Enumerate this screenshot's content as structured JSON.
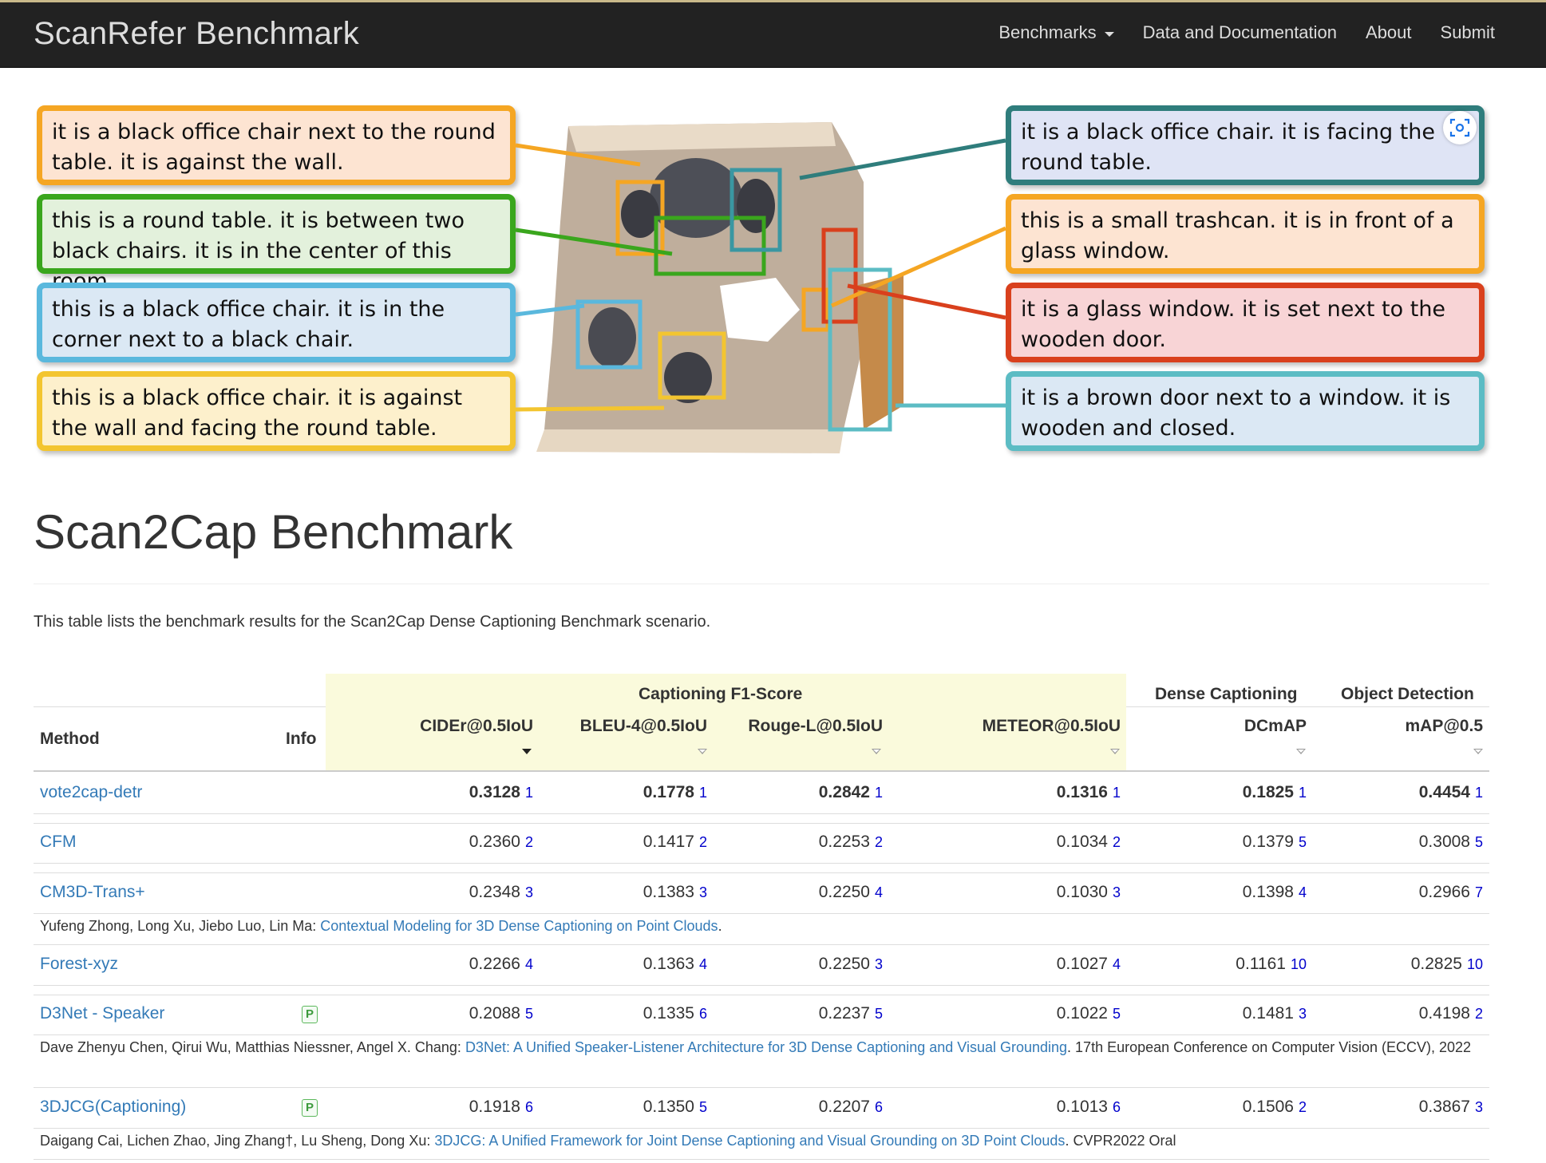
{
  "navbar": {
    "brand": "ScanRefer Benchmark",
    "items": [
      "Benchmarks",
      "Data and Documentation",
      "About",
      "Submit"
    ]
  },
  "teaser": {
    "left_captions": [
      {
        "text": "it is a black office chair next to the round table. it is against the wall.",
        "color": "#f5a623",
        "fill": "#fde4d2"
      },
      {
        "text": "this is a round table. it is between two black chairs. it is in the center of this room.",
        "color": "#3aa61d",
        "fill": "#e3f1dc"
      },
      {
        "text": "this is a black office chair. it is in the corner next to a black chair.",
        "color": "#5ab8dd",
        "fill": "#dbe8f4"
      },
      {
        "text": "this is a black office chair. it is against the wall and facing the round table.",
        "color": "#f3c530",
        "fill": "#fdf0cc"
      }
    ],
    "right_captions": [
      {
        "text": "it is a black office chair. it is facing the round table.",
        "color": "#2f7d7c",
        "fill": "#dfe4f5"
      },
      {
        "text": "this is a small trashcan. it is in front of a glass window.",
        "color": "#f5a623",
        "fill": "#fde4d2"
      },
      {
        "text": "it is a glass window. it is set next to the wooden door.",
        "color": "#d9401d",
        "fill": "#f8d4d6"
      },
      {
        "text": "it is a brown door next to a window. it is wooden and closed.",
        "color": "#5cbcc4",
        "fill": "#dbe8f4"
      }
    ],
    "fullscreen_icon": "focus-scan-icon"
  },
  "page": {
    "title": "Scan2Cap Benchmark",
    "description": "This table lists the benchmark results for the Scan2Cap Dense Captioning Benchmark scenario."
  },
  "table": {
    "group_headers": {
      "captioning": "Captioning F1-Score",
      "dense": "Dense Captioning",
      "detection": "Object Detection"
    },
    "columns": {
      "method": "Method",
      "info": "Info",
      "cider": "CIDEr@0.5IoU",
      "bleu": "BLEU-4@0.5IoU",
      "rouge": "Rouge-L@0.5IoU",
      "meteor": "METEOR@0.5IoU",
      "dcmap": "DCmAP",
      "map": "mAP@0.5"
    },
    "rows": [
      {
        "method": "vote2cap-detr",
        "pub": false,
        "cider": "0.3128",
        "cider_r": "1",
        "bleu": "0.1778",
        "bleu_r": "1",
        "rouge": "0.2842",
        "rouge_r": "1",
        "meteor": "0.1316",
        "meteor_r": "1",
        "dcmap": "0.1825",
        "dcmap_r": "1",
        "map": "0.4454",
        "map_r": "1",
        "bold": true
      },
      {
        "method": "CFM",
        "pub": false,
        "cider": "0.2360",
        "cider_r": "2",
        "bleu": "0.1417",
        "bleu_r": "2",
        "rouge": "0.2253",
        "rouge_r": "2",
        "meteor": "0.1034",
        "meteor_r": "2",
        "dcmap": "0.1379",
        "dcmap_r": "5",
        "map": "0.3008",
        "map_r": "5"
      },
      {
        "method": "CM3D-Trans+",
        "pub": false,
        "cider": "0.2348",
        "cider_r": "3",
        "bleu": "0.1383",
        "bleu_r": "3",
        "rouge": "0.2250",
        "rouge_r": "4",
        "meteor": "0.1030",
        "meteor_r": "3",
        "dcmap": "0.1398",
        "dcmap_r": "4",
        "map": "0.2966",
        "map_r": "7",
        "cite": {
          "authors": "Yufeng Zhong, Long Xu, Jiebo Luo, Lin Ma: ",
          "title": "Contextual Modeling for 3D Dense Captioning on Point Clouds",
          "venue": "."
        }
      },
      {
        "method": "Forest-xyz",
        "pub": false,
        "cider": "0.2266",
        "cider_r": "4",
        "bleu": "0.1363",
        "bleu_r": "4",
        "rouge": "0.2250",
        "rouge_r": "3",
        "meteor": "0.1027",
        "meteor_r": "4",
        "dcmap": "0.1161",
        "dcmap_r": "10",
        "map": "0.2825",
        "map_r": "10"
      },
      {
        "method": "D3Net - Speaker",
        "pub": true,
        "cider": "0.2088",
        "cider_r": "5",
        "bleu": "0.1335",
        "bleu_r": "6",
        "rouge": "0.2237",
        "rouge_r": "5",
        "meteor": "0.1022",
        "meteor_r": "5",
        "dcmap": "0.1481",
        "dcmap_r": "3",
        "map": "0.4198",
        "map_r": "2",
        "cite": {
          "authors": "Dave Zhenyu Chen, Qirui Wu, Matthias Niessner, Angel X. Chang: ",
          "title": "D3Net: A Unified Speaker-Listener Architecture for 3D Dense Captioning and Visual Grounding",
          "venue": ". 17th European Conference on Computer Vision (ECCV), 2022"
        }
      },
      {
        "method": "3DJCG(Captioning)",
        "pub": true,
        "cider": "0.1918",
        "cider_r": "6",
        "bleu": "0.1350",
        "bleu_r": "5",
        "rouge": "0.2207",
        "rouge_r": "6",
        "meteor": "0.1013",
        "meteor_r": "6",
        "dcmap": "0.1506",
        "dcmap_r": "2",
        "map": "0.3867",
        "map_r": "3",
        "cite": {
          "authors": "Daigang Cai, Lichen Zhao, Jing Zhang†, Lu Sheng, Dong Xu: ",
          "title": "3DJCG: A Unified Framework for Joint Dense Captioning and Visual Grounding on 3D Point Clouds",
          "venue": ". CVPR2022 Oral"
        }
      }
    ],
    "pub_badge": "P"
  }
}
